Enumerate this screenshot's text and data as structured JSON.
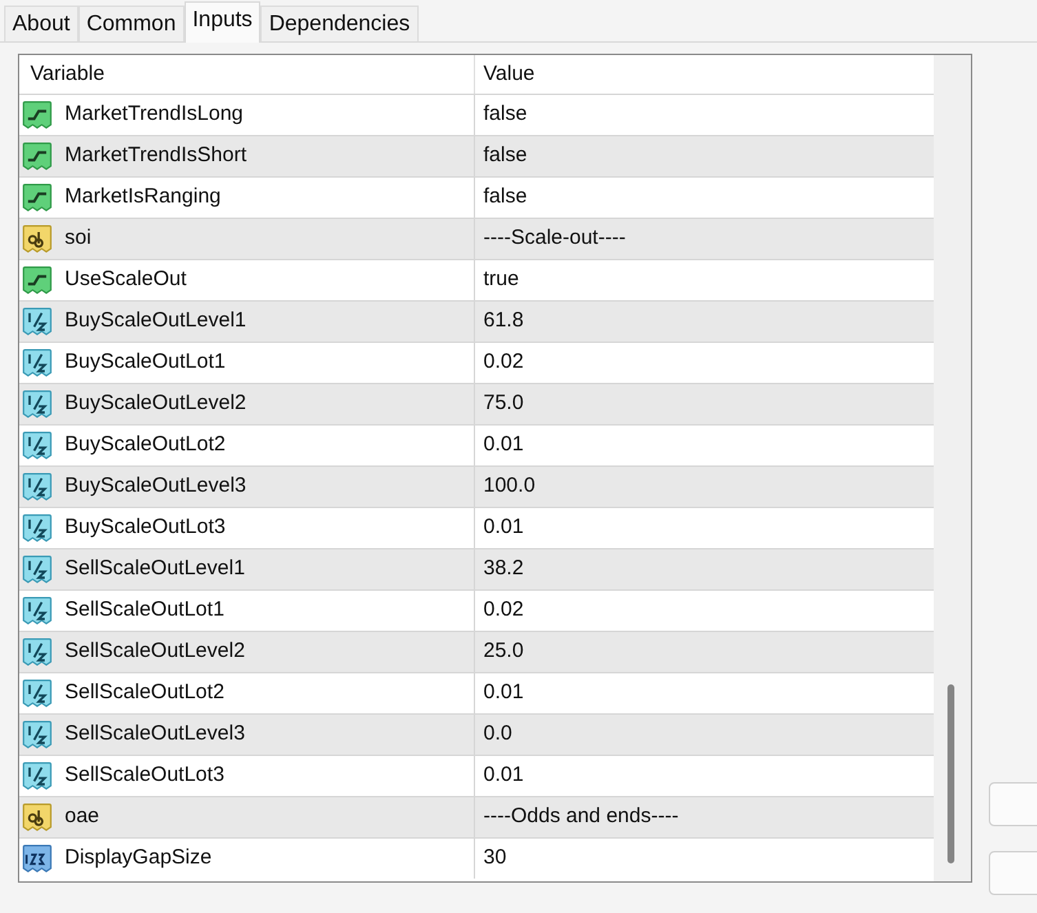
{
  "tabs": [
    {
      "label": "About",
      "selected": false
    },
    {
      "label": "Common",
      "selected": false
    },
    {
      "label": "Inputs",
      "selected": true
    },
    {
      "label": "Dependencies",
      "selected": false
    }
  ],
  "table": {
    "columns": [
      "Variable",
      "Value"
    ],
    "rows": [
      {
        "kind": "bool",
        "variable": "MarketTrendIsLong",
        "value": "false"
      },
      {
        "kind": "bool",
        "variable": "MarketTrendIsShort",
        "value": "false"
      },
      {
        "kind": "bool",
        "variable": "MarketIsRanging",
        "value": "false"
      },
      {
        "kind": "string",
        "variable": "soi",
        "value": "----Scale-out----"
      },
      {
        "kind": "bool",
        "variable": "UseScaleOut",
        "value": "true"
      },
      {
        "kind": "double",
        "variable": "BuyScaleOutLevel1",
        "value": "61.8"
      },
      {
        "kind": "double",
        "variable": "BuyScaleOutLot1",
        "value": "0.02"
      },
      {
        "kind": "double",
        "variable": "BuyScaleOutLevel2",
        "value": "75.0"
      },
      {
        "kind": "double",
        "variable": "BuyScaleOutLot2",
        "value": "0.01"
      },
      {
        "kind": "double",
        "variable": "BuyScaleOutLevel3",
        "value": "100.0"
      },
      {
        "kind": "double",
        "variable": "BuyScaleOutLot3",
        "value": "0.01"
      },
      {
        "kind": "double",
        "variable": "SellScaleOutLevel1",
        "value": "38.2"
      },
      {
        "kind": "double",
        "variable": "SellScaleOutLot1",
        "value": "0.02"
      },
      {
        "kind": "double",
        "variable": "SellScaleOutLevel2",
        "value": "25.0"
      },
      {
        "kind": "double",
        "variable": "SellScaleOutLot2",
        "value": "0.01"
      },
      {
        "kind": "double",
        "variable": "SellScaleOutLevel3",
        "value": "0.0"
      },
      {
        "kind": "double",
        "variable": "SellScaleOutLot3",
        "value": "0.01"
      },
      {
        "kind": "string",
        "variable": "oae",
        "value": "----Odds and ends----"
      },
      {
        "kind": "int",
        "variable": "DisplayGapSize",
        "value": "30"
      }
    ]
  }
}
